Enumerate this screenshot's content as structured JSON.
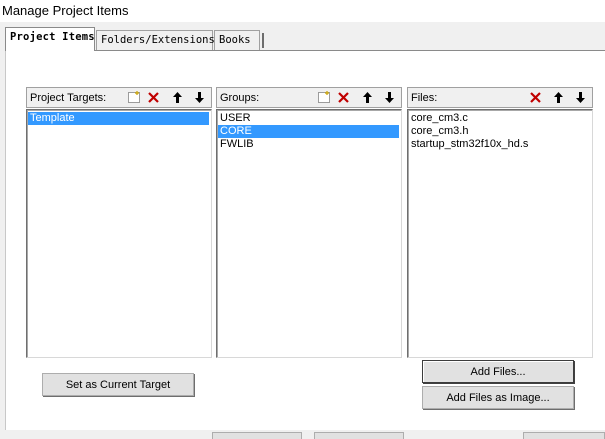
{
  "window": {
    "title": "Manage Project Items"
  },
  "tabs": [
    {
      "label": "Project Items",
      "active": true
    },
    {
      "label": "Folders/Extensions",
      "active": false
    },
    {
      "label": "Books",
      "active": false
    }
  ],
  "targets": {
    "label": "Project Targets:",
    "items": [
      {
        "text": "Template",
        "selected": true
      }
    ],
    "toolbar": [
      "new-icon",
      "delete-icon",
      "move-up-icon",
      "move-down-icon"
    ]
  },
  "groups": {
    "label": "Groups:",
    "items": [
      {
        "text": "USER",
        "selected": false
      },
      {
        "text": "CORE",
        "selected": true
      },
      {
        "text": "FWLIB",
        "selected": false
      }
    ],
    "toolbar": [
      "new-icon",
      "delete-icon",
      "move-up-icon",
      "move-down-icon"
    ]
  },
  "files": {
    "label": "Files:",
    "items": [
      {
        "text": "core_cm3.c",
        "selected": false
      },
      {
        "text": "core_cm3.h",
        "selected": false
      },
      {
        "text": "startup_stm32f10x_hd.s",
        "selected": false
      }
    ],
    "toolbar": [
      "delete-icon",
      "move-up-icon",
      "move-down-icon"
    ]
  },
  "buttons": {
    "set_current_target": "Set as Current Target",
    "add_files": "Add Files...",
    "add_files_as_image": "Add Files as Image..."
  },
  "colors": {
    "selection": "#3399ff",
    "delete_icon": "#c00000",
    "dialog_bg": "#f0f0f0"
  }
}
